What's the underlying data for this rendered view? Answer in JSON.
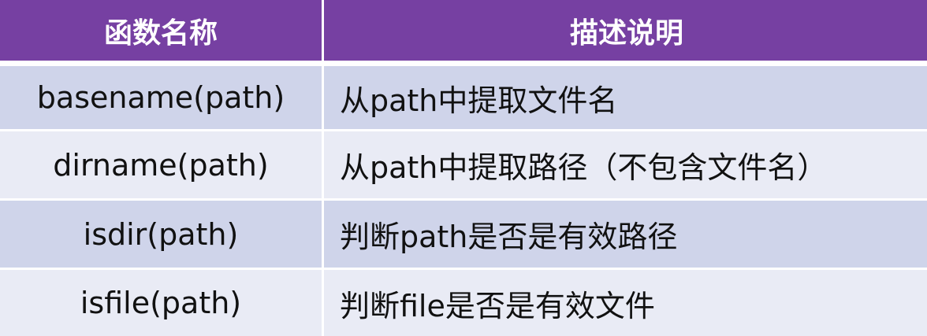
{
  "table": {
    "headers": [
      "函数名称",
      "描述说明"
    ],
    "rows": [
      {
        "function": "basename(path)",
        "description": "从path中提取文件名"
      },
      {
        "function": "dirname(path)",
        "description": "从path中提取路径（不包含文件名）"
      },
      {
        "function": "isdir(path)",
        "description": "判断path是否是有效路径"
      },
      {
        "function": "isfile(path)",
        "description": "判断file是否是有效文件"
      }
    ]
  },
  "colors": {
    "header": "#7640a2",
    "row_dark": "#cfd4ea",
    "row_light": "#e9ebf5"
  }
}
